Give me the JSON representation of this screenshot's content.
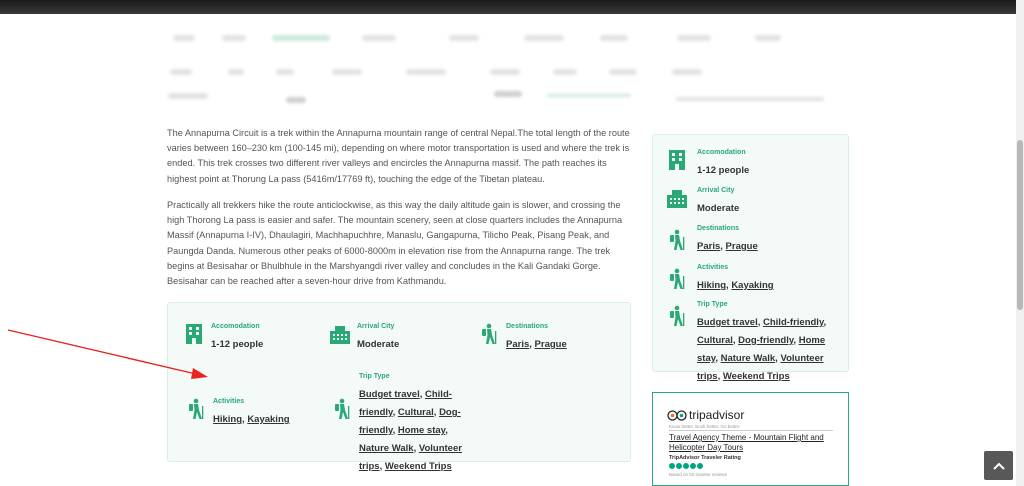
{
  "colors": {
    "accent": "#2aa876",
    "arrow": "#e8231f",
    "header": "#1f1f1f"
  },
  "article": {
    "paragraphs": [
      "The Annapurna Circuit is a trek within the Annapurna mountain range of central Nepal.The total length of the route varies between 160–230 km (100-145 mi), depending on where motor transportation is used and where the trek is ended. This trek crosses two different river valleys and encircles the Annapurna massif. The path reaches its highest point at Thorung La pass (5416m/17769 ft), touching the edge of the Tibetan plateau.",
      "Practically all trekkers hike the route anticlockwise, as this way the daily altitude gain is slower, and crossing the high Thorong La pass is easier and safer. The mountain scenery, seen at close quarters includes the Annapurna Massif (Annapurna I-IV), Dhaulagiri, Machhapuchhre, Manaslu, Gangapurna, Tilicho Peak, Pisang Peak, and Paungda Danda. Numerous other peaks of 6000-8000m in elevation rise from the Annapurna range. The trek begins at Besisahar or Bhulbhule in the Marshyangdi river valley and concludes in the Kali Gandaki Gorge. Besisahar can be reached after a seven-hour drive from Kathmandu."
    ]
  },
  "info": {
    "accommodation": {
      "label": "Accomodation",
      "value": "1-12 people",
      "icon": "building-icon"
    },
    "arrival": {
      "label": "Arrival City",
      "value": "Moderate",
      "icon": "city-icon"
    },
    "destinations": {
      "label": "Destinations",
      "links": [
        "Paris",
        "Prague"
      ],
      "icon": "hiker-icon"
    },
    "activities": {
      "label": "Activities",
      "links": [
        "Hiking",
        "Kayaking"
      ],
      "icon": "hiker-icon"
    },
    "trip_type": {
      "label": "Trip Type",
      "links": [
        "Budget travel",
        "Child-friendly",
        "Cultural",
        "Dog-friendly",
        "Home stay",
        "Nature Walk",
        "Volunteer trips",
        "Weekend Trips"
      ],
      "icon": "hiker-icon"
    }
  },
  "tripadvisor": {
    "brand": "tripadvisor",
    "tagline": "Know better. Book better. Go better.",
    "title": "Travel Agency Theme - Mountain Flight and Helicopter Day Tours",
    "rating_label": "TripAdvisor Traveler Rating",
    "rating": 5,
    "based_on": "Based on 50 traveler reviews"
  },
  "back_to_top": {
    "icon": "chevron-up-icon"
  }
}
